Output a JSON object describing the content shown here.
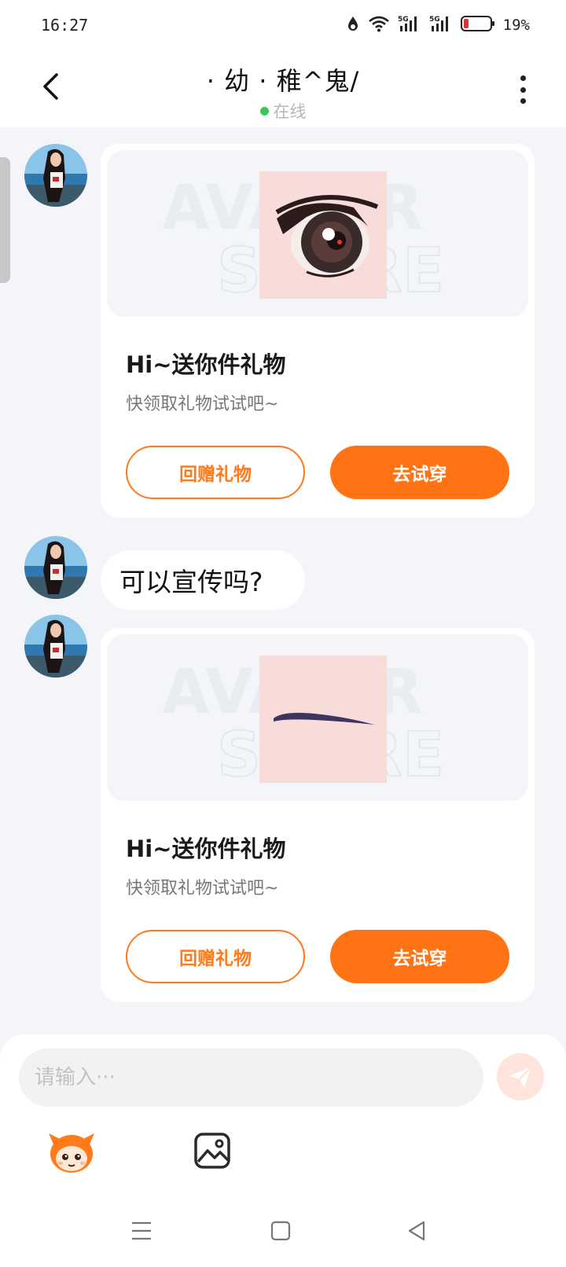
{
  "status_bar": {
    "time": "16:27",
    "battery": "19%",
    "icons": [
      "data-saver-icon",
      "wifi-icon",
      "signal-5g-icon",
      "signal-5g-icon",
      "battery-icon"
    ]
  },
  "header": {
    "title": "· 幼 · 稚^鬼/",
    "status": "在线",
    "status_color": "#3cc65a"
  },
  "messages": [
    {
      "type": "gift",
      "thumb": "eye-sticker",
      "title": "Hi~送你件礼物",
      "subtitle": "快领取礼物试试吧~",
      "return_label": "回赠礼物",
      "try_label": "去试穿"
    },
    {
      "type": "text",
      "text": "可以宣传吗?"
    },
    {
      "type": "gift",
      "thumb": "eyebrow-sticker",
      "title": "Hi~送你件礼物",
      "subtitle": "快领取礼物试试吧~",
      "return_label": "回赠礼物",
      "try_label": "去试穿"
    }
  ],
  "input": {
    "placeholder": "请输入···"
  },
  "toolbar": [
    "emoji-icon",
    "image-icon"
  ],
  "colors": {
    "accent": "#ff7315",
    "background": "#f3f5f8"
  }
}
